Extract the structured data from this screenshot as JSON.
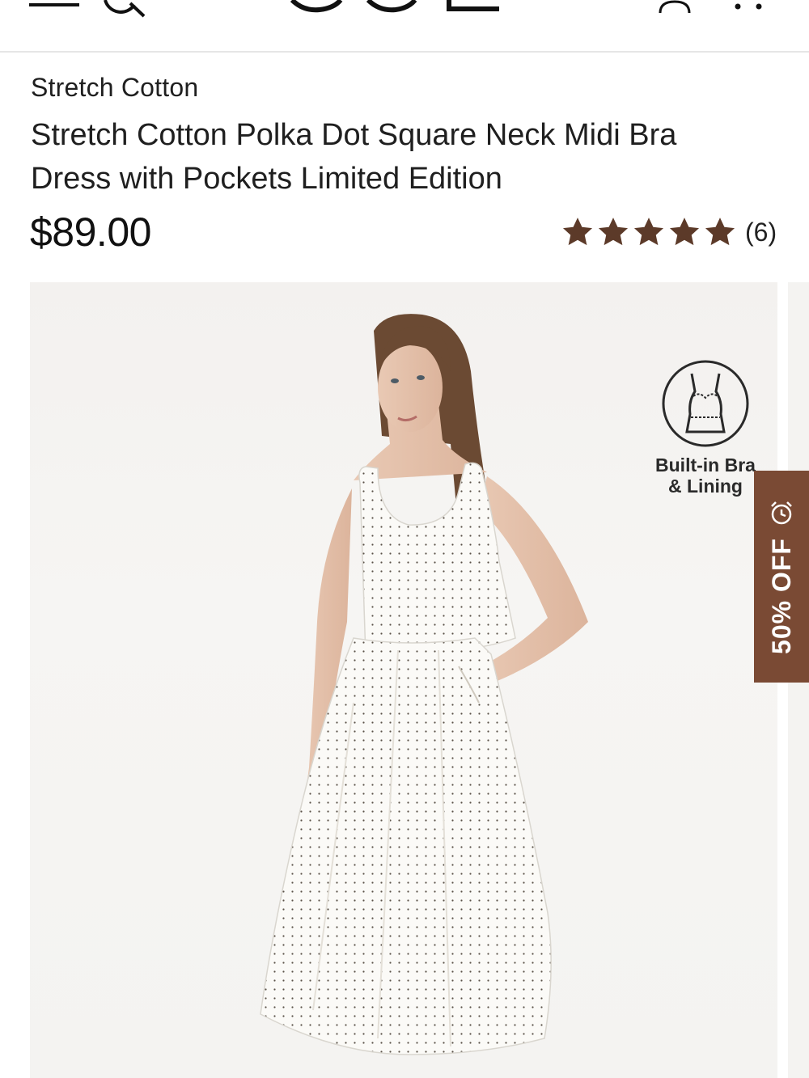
{
  "header": {
    "icons": [
      "menu-icon",
      "search-icon",
      "account-icon",
      "shopping-bag-icon"
    ],
    "logo_name": "brand-logo"
  },
  "product": {
    "collection": "Stretch Cotton",
    "title": "Stretch Cotton Polka Dot Square Neck Midi Bra Dress with Pockets Limited Edition",
    "price": "$89.00",
    "rating": 5,
    "rating_max": 5,
    "review_count": "(6)"
  },
  "gallery": {
    "badge_label_line1": "Built-in Bra",
    "badge_label_line2": "& Lining",
    "badge_icon": "bra-lining-icon"
  },
  "promo": {
    "discount_label": "50% OFF",
    "icon": "alarm-clock-icon",
    "color": "#7a4a34"
  },
  "colors": {
    "star": "#5c3a29",
    "accent": "#7a4a34",
    "text": "#1f1f1f"
  }
}
